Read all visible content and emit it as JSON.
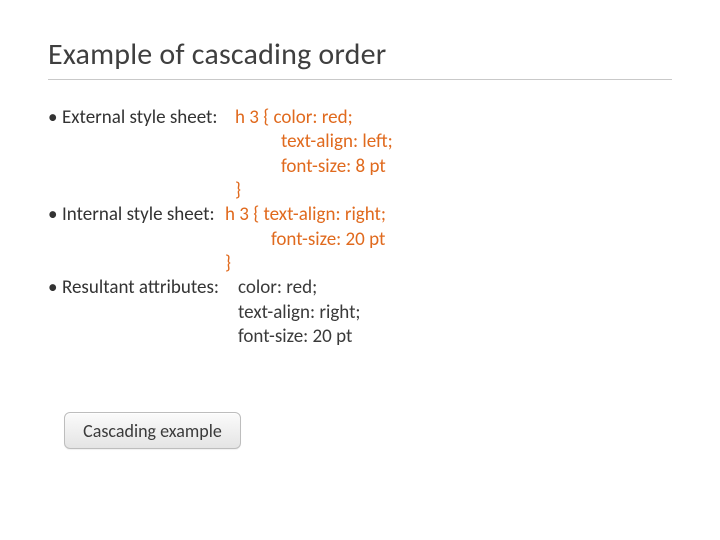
{
  "title": "Example of cascading order",
  "bullets": {
    "external_label": "External style sheet: ",
    "internal_label": "Internal style sheet: ",
    "resultant_label": "Resultant attributes: "
  },
  "code": {
    "ext_selector": "h 3 { ",
    "ext_prop1": "color: red;",
    "ext_prop2": "text-align: left;",
    "ext_prop3": "font-size: 8 pt",
    "ext_close": "}",
    "int_selector": "h 3 { ",
    "int_prop1": "text-align: right;",
    "int_prop2": "font-size: 20 pt",
    "int_close": "}",
    "res_prop1": "color: red;",
    "res_prop2": "text-align: right;",
    "res_prop3": "font-size: 20 pt"
  },
  "button_label": "Cascading example"
}
